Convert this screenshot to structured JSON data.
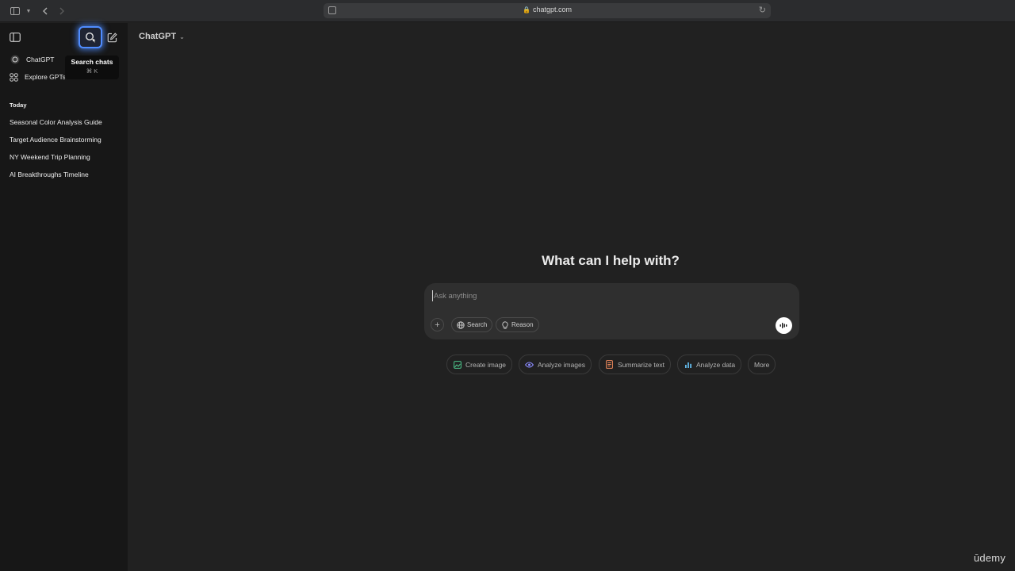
{
  "browser": {
    "url": "chatgpt.com"
  },
  "sidebar": {
    "nav": [
      {
        "label": "ChatGPT",
        "icon": "chatgpt-logo-icon"
      },
      {
        "label": "Explore GPTs",
        "icon": "grid-icon"
      }
    ],
    "tooltip": {
      "title": "Search chats",
      "shortcut": "⌘ K"
    },
    "section_label": "Today",
    "history": [
      "Seasonal Color Analysis Guide",
      "Target Audience Brainstorming",
      "NY Weekend Trip Planning",
      "AI Breakthroughs Timeline"
    ]
  },
  "main": {
    "model_label": "ChatGPT",
    "headline": "What can I help with?",
    "composer": {
      "placeholder": "Ask anything",
      "search_label": "Search",
      "reason_label": "Reason"
    },
    "suggestions": [
      {
        "label": "Create image",
        "icon": "image-icon",
        "color": "#4cc38a"
      },
      {
        "label": "Analyze images",
        "icon": "eye-icon",
        "color": "#8b8bff"
      },
      {
        "label": "Summarize text",
        "icon": "document-icon",
        "color": "#f08a5d"
      },
      {
        "label": "Analyze data",
        "icon": "bar-chart-icon",
        "color": "#62b8e8"
      },
      {
        "label": "More",
        "icon": "",
        "color": ""
      }
    ]
  },
  "watermark": "ūdemy",
  "colors": {
    "focus_ring": "#4f8cff",
    "sidebar_bg": "#171717",
    "main_bg": "#212121",
    "composer_bg": "#2f2f2f"
  }
}
